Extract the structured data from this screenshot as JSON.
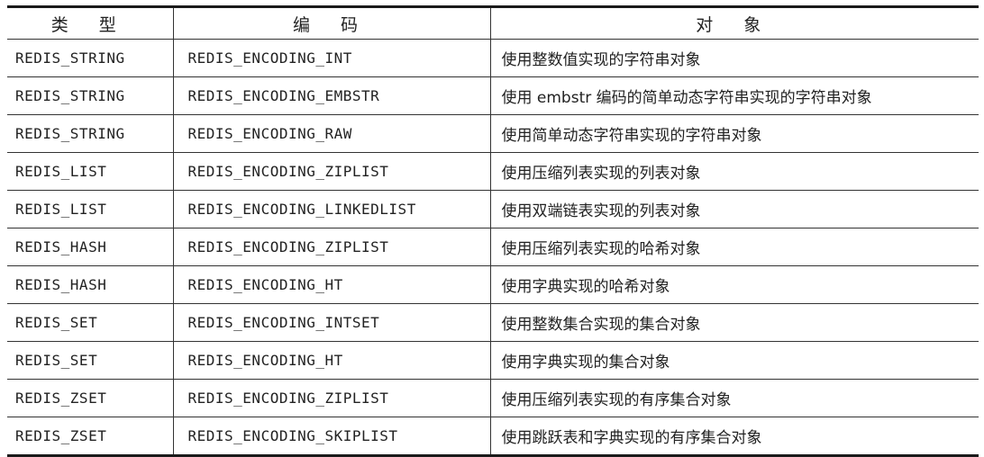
{
  "table": {
    "headers": [
      "类 型",
      "编 码",
      "对 象"
    ],
    "rows": [
      {
        "type": "REDIS_STRING",
        "encoding": "REDIS_ENCODING_INT",
        "object": "使用整数值实现的字符串对象"
      },
      {
        "type": "REDIS_STRING",
        "encoding": "REDIS_ENCODING_EMBSTR",
        "object": "使用 embstr 编码的简单动态字符串实现的字符串对象"
      },
      {
        "type": "REDIS_STRING",
        "encoding": "REDIS_ENCODING_RAW",
        "object": "使用简单动态字符串实现的字符串对象"
      },
      {
        "type": "REDIS_LIST",
        "encoding": "REDIS_ENCODING_ZIPLIST",
        "object": "使用压缩列表实现的列表对象"
      },
      {
        "type": "REDIS_LIST",
        "encoding": "REDIS_ENCODING_LINKEDLIST",
        "object": "使用双端链表实现的列表对象"
      },
      {
        "type": "REDIS_HASH",
        "encoding": "REDIS_ENCODING_ZIPLIST",
        "object": "使用压缩列表实现的哈希对象"
      },
      {
        "type": "REDIS_HASH",
        "encoding": "REDIS_ENCODING_HT",
        "object": "使用字典实现的哈希对象"
      },
      {
        "type": "REDIS_SET",
        "encoding": "REDIS_ENCODING_INTSET",
        "object": "使用整数集合实现的集合对象"
      },
      {
        "type": "REDIS_SET",
        "encoding": "REDIS_ENCODING_HT",
        "object": "使用字典实现的集合对象"
      },
      {
        "type": "REDIS_ZSET",
        "encoding": "REDIS_ENCODING_ZIPLIST",
        "object": "使用压缩列表实现的有序集合对象"
      },
      {
        "type": "REDIS_ZSET",
        "encoding": "REDIS_ENCODING_SKIPLIST",
        "object": "使用跳跃表和字典实现的有序集合对象"
      }
    ]
  }
}
